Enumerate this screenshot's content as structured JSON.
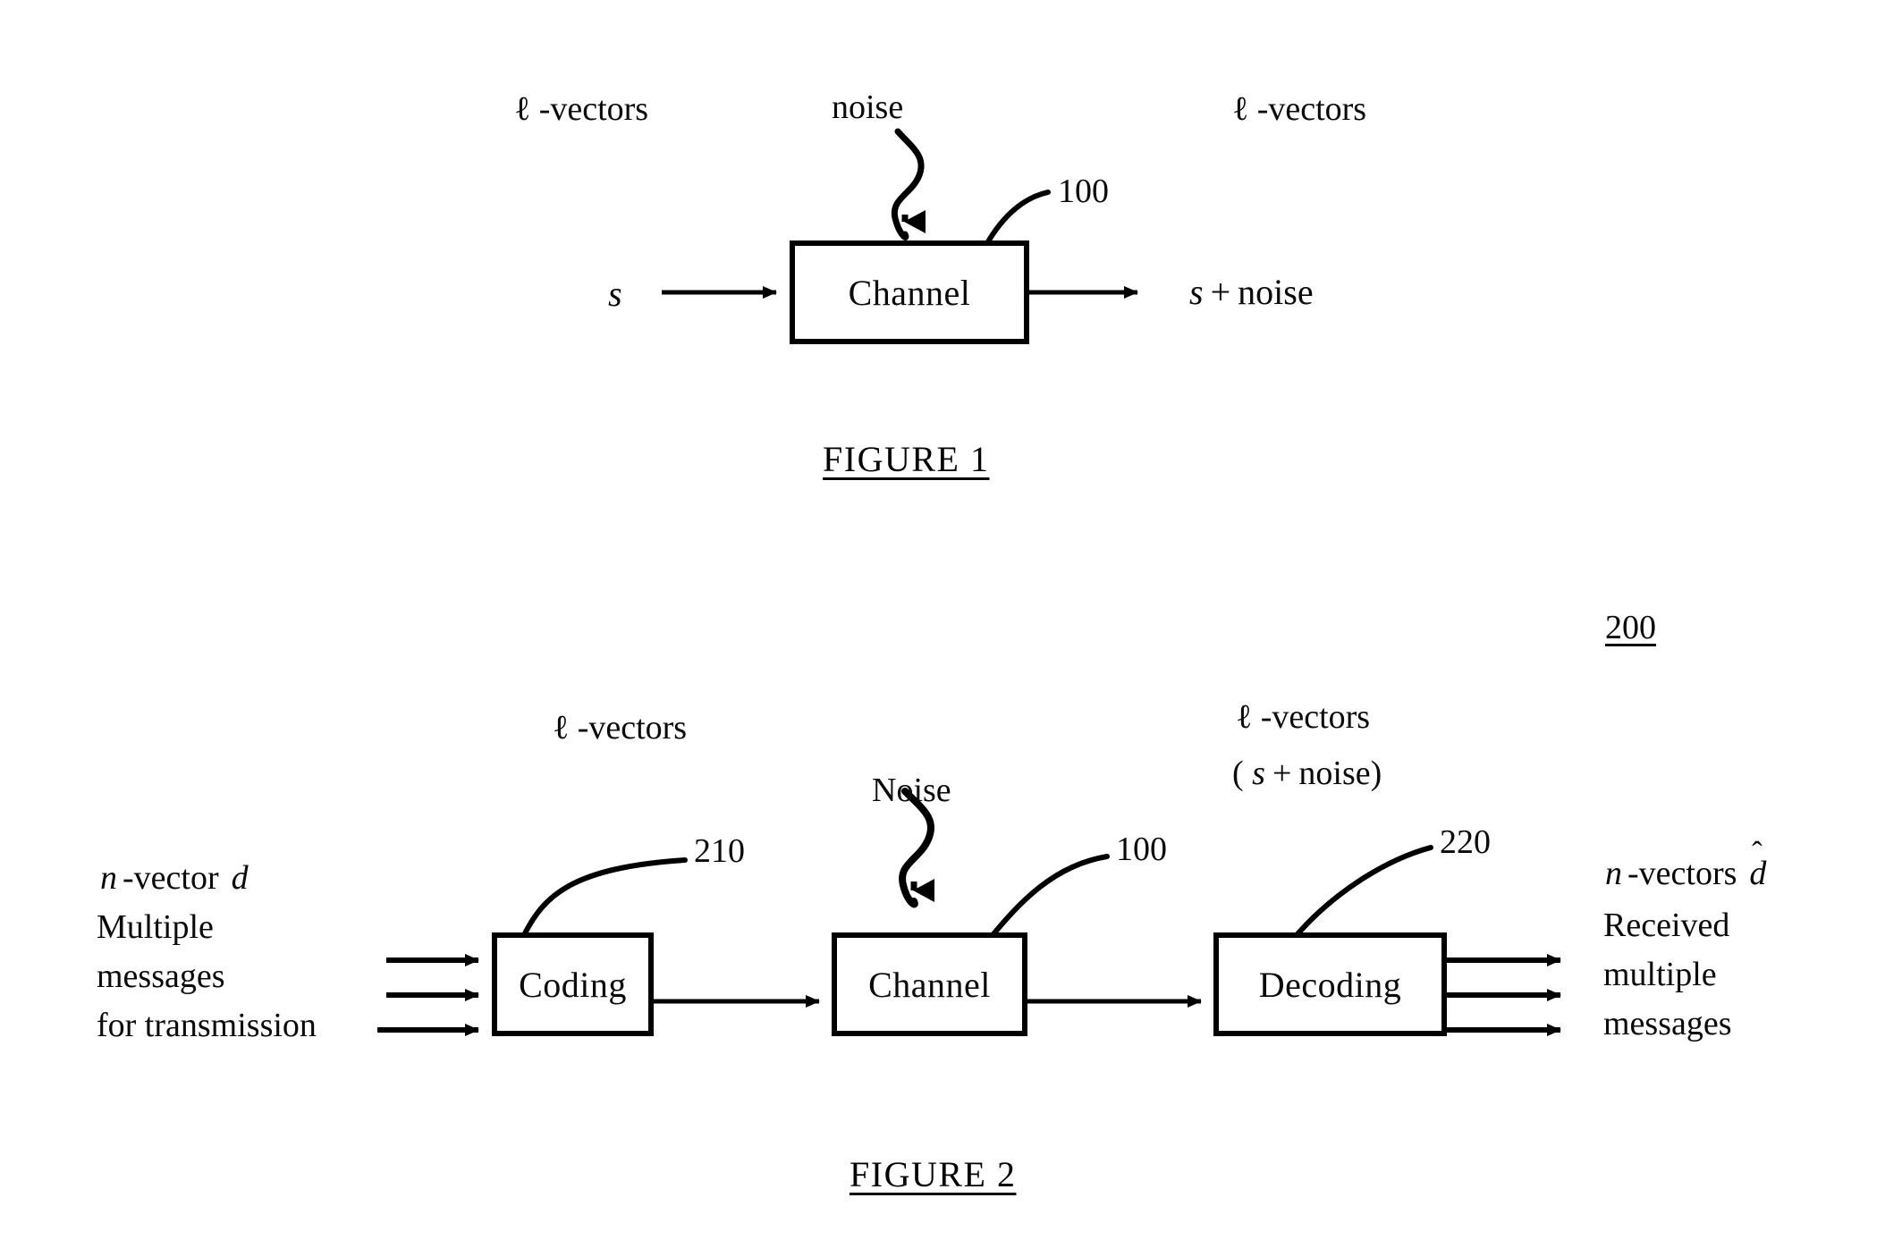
{
  "document": {
    "type": "patent-figure-sheet",
    "background": "#ffffff",
    "ink": "#000000"
  },
  "figure1": {
    "caption": "FIGURE 1",
    "reference": "100",
    "block": {
      "label": "Channel"
    },
    "labels": {
      "input_vectors": "ℓ -vectors",
      "noise": "noise",
      "output_vectors": "ℓ -vectors",
      "input_signal": "s",
      "output_signal_prefix": "s",
      "output_signal_plus": "+",
      "output_signal_suffix": "noise",
      "output_signal": "s + noise"
    }
  },
  "figure2": {
    "caption": "FIGURE 2",
    "system_reference": "200",
    "blocks": [
      {
        "label": "Coding",
        "reference": "210"
      },
      {
        "label": "Channel",
        "reference": "100"
      },
      {
        "label": "Decoding",
        "reference": "220"
      }
    ],
    "labels": {
      "coding_input_vectors": "ℓ -vectors",
      "noise": "Noise",
      "decoder_input_vectors": "ℓ -vectors",
      "decoder_input_expr": "( s + noise )",
      "left_line1_var": "n",
      "left_line1_text": "-vector",
      "left_line1_symbol": "d",
      "left_line2": "Multiple",
      "left_line3": "messages",
      "left_line4": "for transmission",
      "right_line1_var": "n",
      "right_line1_text": "-vectors",
      "right_line1_symbol": "d",
      "right_line1_accent": "ˆ",
      "right_line2": "Received",
      "right_line3": "multiple",
      "right_line4": "messages"
    }
  }
}
